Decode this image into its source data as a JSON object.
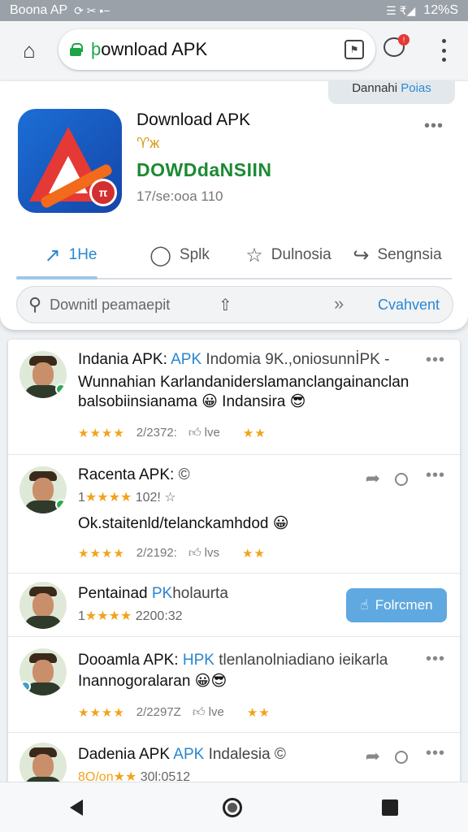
{
  "statusbar": {
    "app_name": "Boona AP",
    "left_icons": "⟳ ✂ ▪−",
    "right_icons": "☰ ₹◢",
    "battery": "12%S"
  },
  "toolbar": {
    "url_prefix": "þ",
    "url_text": "ownload APK",
    "tab_count": "⚑",
    "chat_badge": "!"
  },
  "app": {
    "pill_top_a": "Dannahi ",
    "pill_top_b": "Poias",
    "title": "Download APK",
    "subtitle": "♈ж",
    "brand": "DOWDdaNSIIN",
    "meta": "17/se:ooa 110",
    "badge": "π"
  },
  "tabs": [
    {
      "icon": "↗",
      "label": "1He"
    },
    {
      "icon": "◯",
      "label": "Splk"
    },
    {
      "icon": "☆",
      "label": "Dulnosia"
    },
    {
      "icon": "↪",
      "label": "Sengnsia"
    }
  ],
  "search": {
    "text": "Downitl peamaepit",
    "action": "Cvahvent"
  },
  "feed": [
    {
      "title_a": "Indania APK: ",
      "title_b": "APK",
      "title_c": " Indomia 9K.,oniosunnİPK -",
      "body_1": "Wunnahian Karlandaniderslamanclangainanclan",
      "body_2": "balsobiinsianama 😀 Indansira 😎",
      "stars": "★★★★",
      "date": "2/2372:",
      "likes": "👍︎ lve",
      "stars2": "★★"
    },
    {
      "title_a": "Racenta APK: ",
      "title_b": "",
      "title_c": "©",
      "line2_a": "1",
      "line2_stars": "★★★★",
      "line2_b": " 102! ☆",
      "body_1": "Ok.staitenld/telanckamhdod 😀",
      "stars": "★★★★",
      "date": "2/2192:",
      "likes": "👍︎ lvs",
      "stars2": "★★"
    },
    {
      "title_a": "Pentainad ",
      "title_b": "PK",
      "title_c": "holaurta",
      "line2_a": "1",
      "line2_stars": "★★★★",
      "line2_b": " 2200:32",
      "button": "Folrcmen"
    },
    {
      "title_a": "Dooamla APK: ",
      "title_b": "HPK",
      "title_c": " tlenlanolniadiano ieikarla",
      "body_1": "Inannogoralaran 😀😎",
      "stars": "★★★★",
      "date": "2/2297Z",
      "likes": "👍︎ lve",
      "stars2": "★★"
    },
    {
      "title_a": "Dadenia APK ",
      "title_b": "APK",
      "title_c": " Indalesia ©",
      "line2_a": "8O/on",
      "line2_stars": "★★",
      "line2_b": " 30l:0512"
    }
  ]
}
